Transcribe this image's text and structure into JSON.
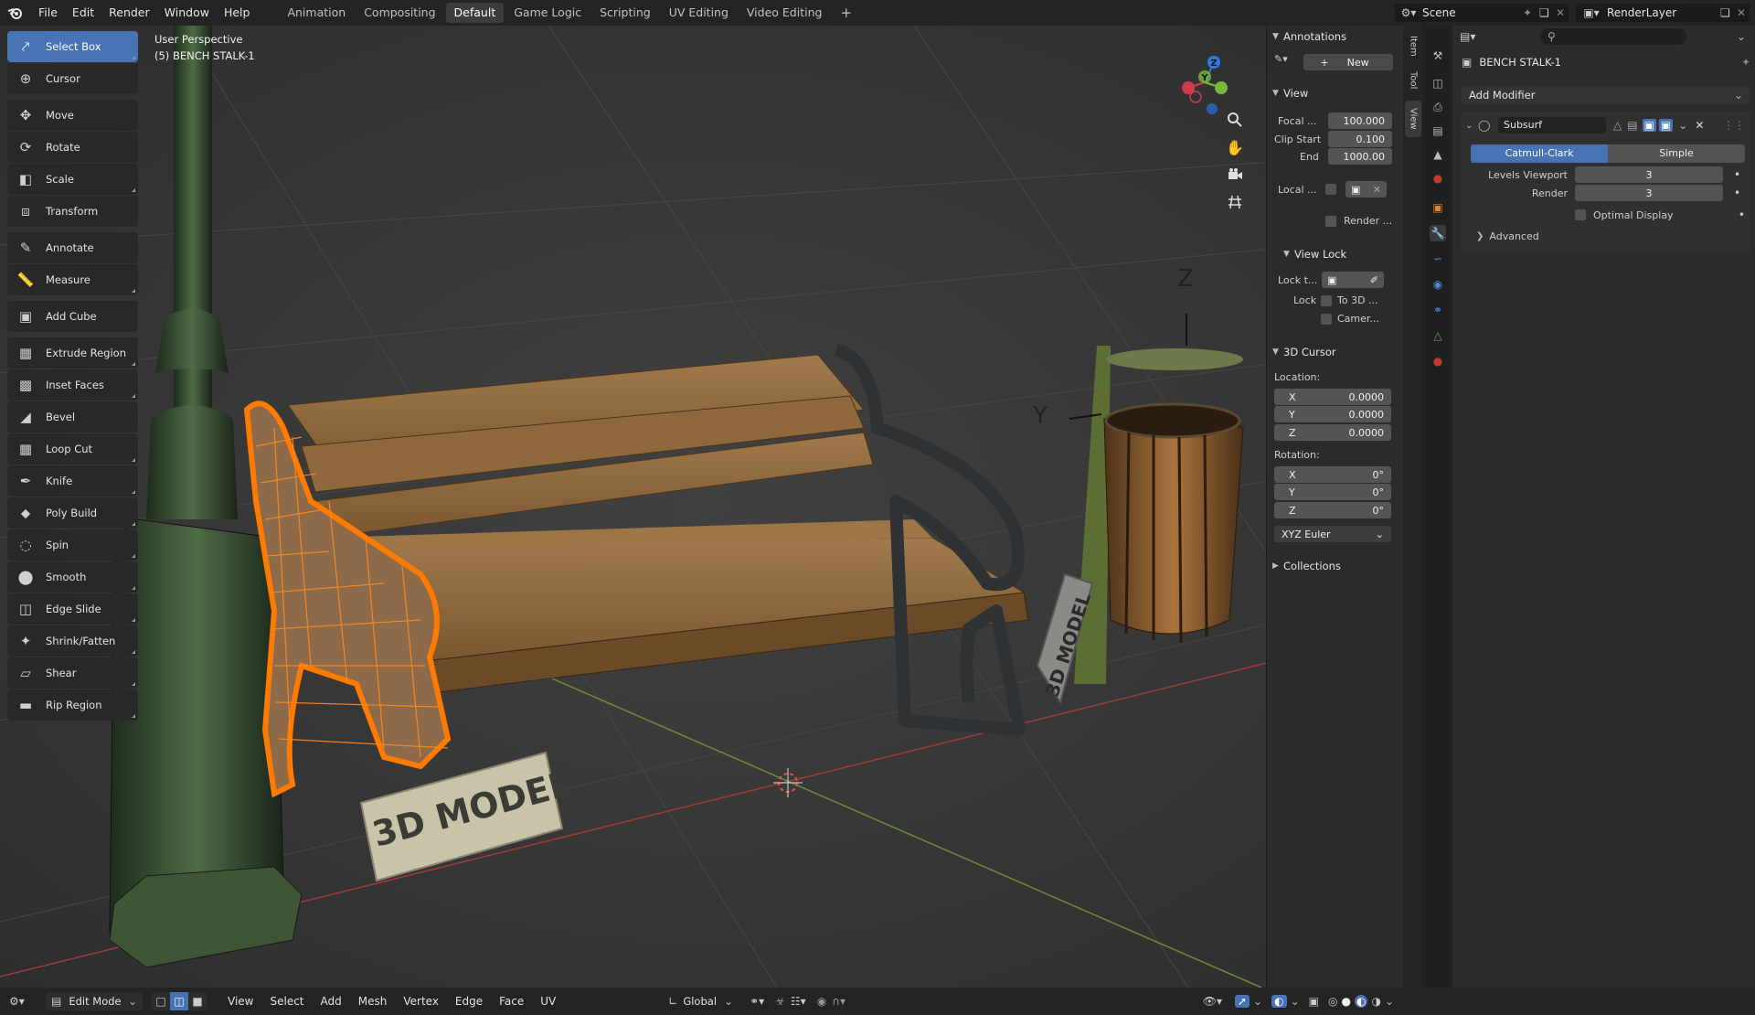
{
  "topbar": {
    "menus": [
      "File",
      "Edit",
      "Render",
      "Window",
      "Help"
    ],
    "workspaces": [
      "Animation",
      "Compositing",
      "Default",
      "Game Logic",
      "Scripting",
      "UV Editing",
      "Video Editing"
    ],
    "active_workspace": "Default",
    "add_tab": "+",
    "scene_name": "Scene",
    "render_layer": "RenderLayer"
  },
  "toolbar": {
    "tools": [
      {
        "label": "Select Box",
        "icon": "select-box-icon"
      },
      {
        "label": "Cursor",
        "icon": "cursor-icon"
      },
      {
        "label": "Move",
        "icon": "move-icon"
      },
      {
        "label": "Rotate",
        "icon": "rotate-icon"
      },
      {
        "label": "Scale",
        "icon": "scale-icon"
      },
      {
        "label": "Transform",
        "icon": "transform-icon"
      },
      {
        "label": "Annotate",
        "icon": "annotate-icon"
      },
      {
        "label": "Measure",
        "icon": "measure-icon"
      },
      {
        "label": "Add Cube",
        "icon": "add-cube-icon"
      },
      {
        "label": "Extrude Region",
        "icon": "extrude-icon"
      },
      {
        "label": "Inset Faces",
        "icon": "inset-icon"
      },
      {
        "label": "Bevel",
        "icon": "bevel-icon"
      },
      {
        "label": "Loop Cut",
        "icon": "loop-cut-icon"
      },
      {
        "label": "Knife",
        "icon": "knife-icon"
      },
      {
        "label": "Poly Build",
        "icon": "poly-build-icon"
      },
      {
        "label": "Spin",
        "icon": "spin-icon"
      },
      {
        "label": "Smooth",
        "icon": "smooth-icon"
      },
      {
        "label": "Edge Slide",
        "icon": "edge-slide-icon"
      },
      {
        "label": "Shrink/Fatten",
        "icon": "shrink-fatten-icon"
      },
      {
        "label": "Shear",
        "icon": "shear-icon"
      },
      {
        "label": "Rip Region",
        "icon": "rip-region-icon"
      }
    ]
  },
  "viewport": {
    "view_name": "User Perspective",
    "object_info": "(5) BENCH STALK-1",
    "sign_text": "3D MODEL",
    "gizmo_axes": [
      "Z",
      "Y",
      "X"
    ]
  },
  "npanel": {
    "annotations_title": "Annotations",
    "new_label": "New",
    "view_title": "View",
    "focal_label": "Focal ...",
    "focal_value": "100.000",
    "clip_start_label": "Clip Start",
    "clip_start_value": "0.100",
    "end_label": "End",
    "end_value": "1000.00",
    "local_label": "Local ...",
    "render_label": "Render ...",
    "view_lock_title": "View Lock",
    "lock_to_label": "Lock t...",
    "lock_label": "Lock",
    "to3d_label": "To 3D ...",
    "camera_label": "Camer...",
    "cursor_title": "3D Cursor",
    "location_label": "Location:",
    "loc_x": "0.0000",
    "loc_y": "0.0000",
    "loc_z": "0.0000",
    "rotation_label": "Rotation:",
    "rot_x": "0°",
    "rot_y": "0°",
    "rot_z": "0°",
    "axis_x": "X",
    "axis_y": "Y",
    "axis_z": "Z",
    "euler": "XYZ Euler",
    "collections_title": "Collections",
    "tabs": [
      "Item",
      "Tool",
      "View"
    ]
  },
  "properties": {
    "object_name": "BENCH STALK-1",
    "add_modifier": "Add Modifier",
    "modifier_name": "Subsurf",
    "catmull": "Catmull-Clark",
    "simple": "Simple",
    "levels_label": "Levels Viewport",
    "levels_value": "3",
    "render_label": "Render",
    "render_value": "3",
    "optimal_label": "Optimal Display",
    "advanced_label": "Advanced"
  },
  "bottombar": {
    "mode": "Edit Mode",
    "menus": [
      "View",
      "Select",
      "Add",
      "Mesh",
      "Vertex",
      "Edge",
      "Face",
      "UV"
    ],
    "orientation": "Global"
  },
  "colors": {
    "accent": "#4772b3",
    "selection": "#ff7a00",
    "x_axis": "#d23b4f",
    "y_axis": "#79b93a",
    "z_axis": "#2f7ce0"
  }
}
